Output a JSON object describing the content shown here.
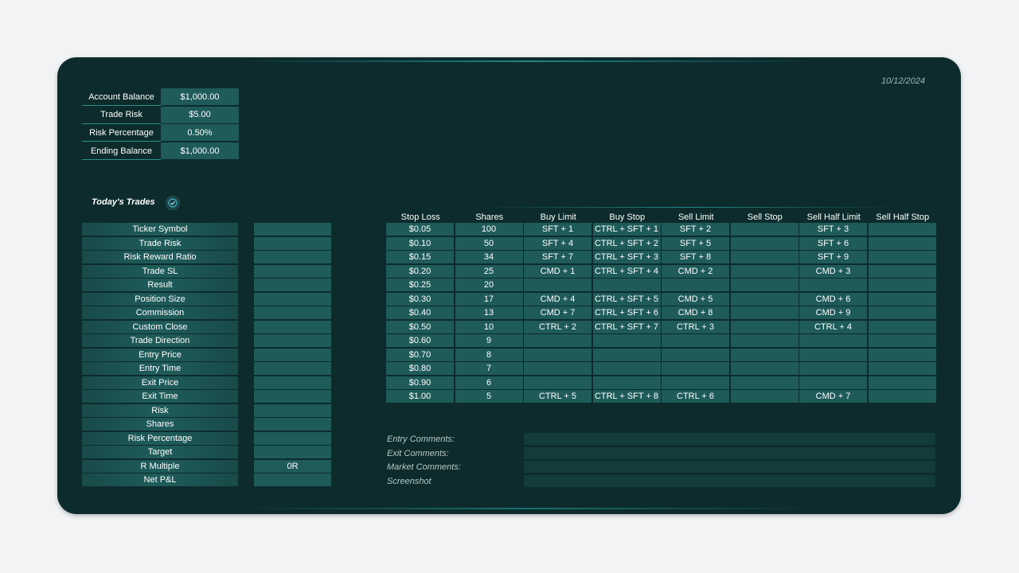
{
  "date": "10/12/2024",
  "summary": [
    {
      "label": "Account Balance",
      "value": "$1,000.00"
    },
    {
      "label": "Trade Risk",
      "value": "$5.00"
    },
    {
      "label": "Risk Percentage",
      "value": "0.50%"
    },
    {
      "label": "Ending Balance",
      "value": "$1,000.00"
    }
  ],
  "todays_trades": {
    "title": "Today's Trades",
    "fields": [
      {
        "label": "Ticker Symbol",
        "value": ""
      },
      {
        "label": "Trade Risk",
        "value": ""
      },
      {
        "label": "Risk Reward Ratio",
        "value": ""
      },
      {
        "label": "Trade SL",
        "value": ""
      },
      {
        "label": "Result",
        "value": ""
      },
      {
        "label": "Position Size",
        "value": ""
      },
      {
        "label": "Commission",
        "value": ""
      },
      {
        "label": "Custom Close",
        "value": ""
      },
      {
        "label": "Trade Direction",
        "value": ""
      },
      {
        "label": "Entry Price",
        "value": ""
      },
      {
        "label": "Entry Time",
        "value": ""
      },
      {
        "label": "Exit Price",
        "value": ""
      },
      {
        "label": "Exit Time",
        "value": ""
      },
      {
        "label": "Risk",
        "value": ""
      },
      {
        "label": "Shares",
        "value": ""
      },
      {
        "label": "Risk Percentage",
        "value": ""
      },
      {
        "label": "Target",
        "value": ""
      },
      {
        "label": "R Multiple",
        "value": "0R"
      },
      {
        "label": "Net P&L",
        "value": ""
      }
    ]
  },
  "hotkeys": {
    "headers": [
      "Stop Loss",
      "Shares",
      "Buy Limit",
      "Buy Stop",
      "Sell Limit",
      "Sell Stop",
      "Sell Half Limit",
      "Sell Half Stop"
    ],
    "rows": [
      [
        "$0.05",
        "100",
        "SFT + 1",
        "CTRL + SFT + 1",
        "SFT + 2",
        "",
        "SFT + 3",
        ""
      ],
      [
        "$0.10",
        "50",
        "SFT + 4",
        "CTRL + SFT + 2",
        "SFT + 5",
        "",
        "SFT + 6",
        ""
      ],
      [
        "$0.15",
        "34",
        "SFT + 7",
        "CTRL + SFT + 3",
        "SFT + 8",
        "",
        "SFT + 9",
        ""
      ],
      [
        "$0.20",
        "25",
        "CMD + 1",
        "CTRL + SFT + 4",
        "CMD + 2",
        "",
        "CMD + 3",
        ""
      ],
      [
        "$0.25",
        "20",
        "",
        "",
        "",
        "",
        "",
        ""
      ],
      [
        "$0.30",
        "17",
        "CMD + 4",
        "CTRL + SFT + 5",
        "CMD + 5",
        "",
        "CMD + 6",
        ""
      ],
      [
        "$0.40",
        "13",
        "CMD + 7",
        "CTRL + SFT + 6",
        "CMD + 8",
        "",
        "CMD + 9",
        ""
      ],
      [
        "$0.50",
        "10",
        "CTRL + 2",
        "CTRL + SFT + 7",
        "CTRL + 3",
        "",
        "CTRL + 4",
        ""
      ],
      [
        "$0.60",
        "9",
        "",
        "",
        "",
        "",
        "",
        ""
      ],
      [
        "$0.70",
        "8",
        "",
        "",
        "",
        "",
        "",
        ""
      ],
      [
        "$0.80",
        "7",
        "",
        "",
        "",
        "",
        "",
        ""
      ],
      [
        "$0.90",
        "6",
        "",
        "",
        "",
        "",
        "",
        ""
      ],
      [
        "$1.00",
        "5",
        "CTRL + 5",
        "CTRL + SFT + 8",
        "CTRL + 6",
        "",
        "CMD + 7",
        ""
      ]
    ]
  },
  "comments": [
    {
      "label": "Entry Comments:",
      "value": ""
    },
    {
      "label": "Exit Comments:",
      "value": ""
    },
    {
      "label": "Market Comments:",
      "value": ""
    },
    {
      "label": "Screenshot",
      "value": ""
    }
  ],
  "icons": {
    "trades_badge": "check-circle-icon"
  },
  "colors": {
    "panel": "#0d2b2c",
    "cell": "#1e5b59",
    "accent": "#2b8f8e"
  }
}
